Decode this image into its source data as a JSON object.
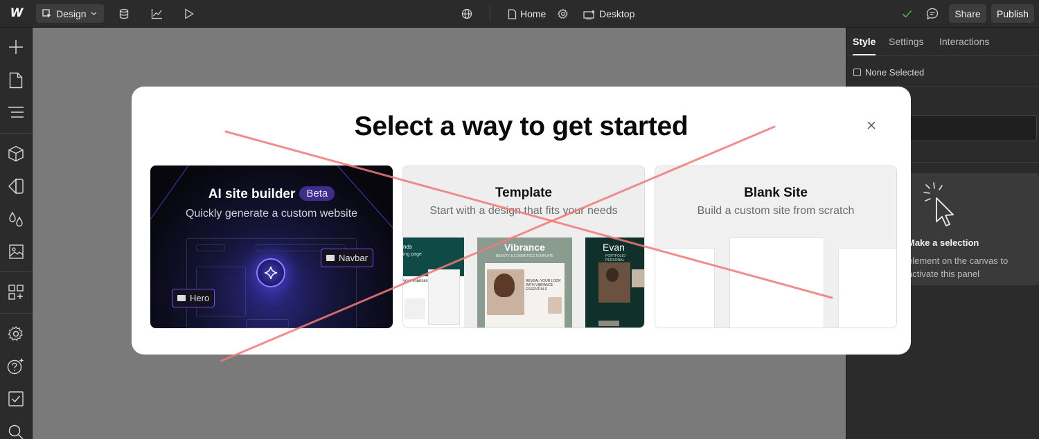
{
  "topbar": {
    "logo": "W",
    "mode_label": "Design",
    "page_label": "Home",
    "breakpoint_label": "Desktop",
    "share_label": "Share",
    "publish_label": "Publish"
  },
  "right_panel": {
    "tabs": [
      {
        "label": "Style",
        "active": true
      },
      {
        "label": "Settings",
        "active": false
      },
      {
        "label": "Interactions",
        "active": false
      }
    ],
    "selection_label": "None Selected",
    "empty_title": "Make a selection",
    "empty_text": "element on the canvas to activate this panel"
  },
  "modal": {
    "title": "Select a way to get started",
    "options": [
      {
        "title": "AI site builder",
        "badge": "Beta",
        "subtitle": "Quickly generate a custom website",
        "tags": [
          "Navbar",
          "Hero"
        ]
      },
      {
        "title": "Template",
        "subtitle": "Start with a design that fits your needs",
        "thumbnails": [
          {
            "headline": "nds",
            "sub": "ing page",
            "body": "your finances"
          },
          {
            "headline": "Vibrance",
            "sub": "BEAUTY & COSMETICS TEMPLATE",
            "body": "REVEAL YOUR LOOK WITH VIBRANCE ESSENTIALS"
          },
          {
            "headline": "Evan",
            "sub": "PORTFOLIO · PERSONAL"
          }
        ]
      },
      {
        "title": "Blank Site",
        "subtitle": "Build a custom site from scratch"
      }
    ]
  },
  "colors": {
    "chrome_bg": "#2b2b2b",
    "canvas_bg": "#7a7a7a",
    "accent_purple": "#7c4dff",
    "success_green": "#4caf50",
    "strike_red": "#f07070"
  }
}
